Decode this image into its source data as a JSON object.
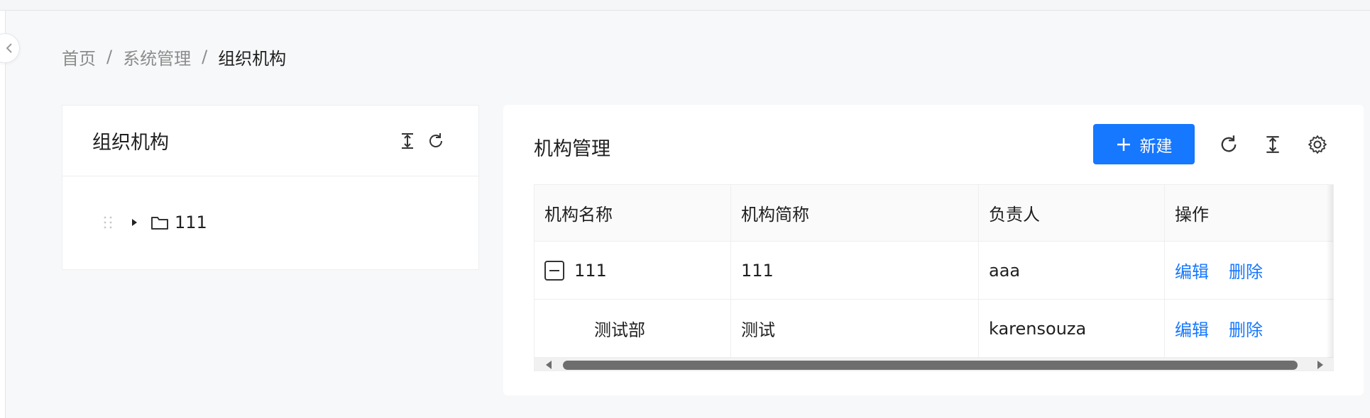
{
  "breadcrumb": {
    "items": [
      "首页",
      "系统管理",
      "组织机构"
    ],
    "separator": "/"
  },
  "org_panel": {
    "title": "组织机构",
    "icons": [
      "collapse-all-icon",
      "refresh-icon"
    ],
    "tree": [
      {
        "label": "111",
        "expanded": false
      }
    ]
  },
  "manage_panel": {
    "title": "机构管理",
    "new_button": "新建",
    "toolbar_icons": [
      "refresh-icon",
      "column-height-icon",
      "settings-icon"
    ],
    "table": {
      "columns": [
        "机构名称",
        "机构简称",
        "负责人",
        "操作"
      ],
      "rows": [
        {
          "name": "111",
          "short": "111",
          "owner": "aaa",
          "expanded": true
        },
        {
          "name": "测试部",
          "short": "测试",
          "owner": "karensouza"
        }
      ],
      "actions": {
        "edit": "编辑",
        "delete": "删除"
      }
    }
  },
  "colors": {
    "primary": "#1677ff",
    "background": "#f5f6f8",
    "card": "#ffffff",
    "border": "#eceef1"
  }
}
